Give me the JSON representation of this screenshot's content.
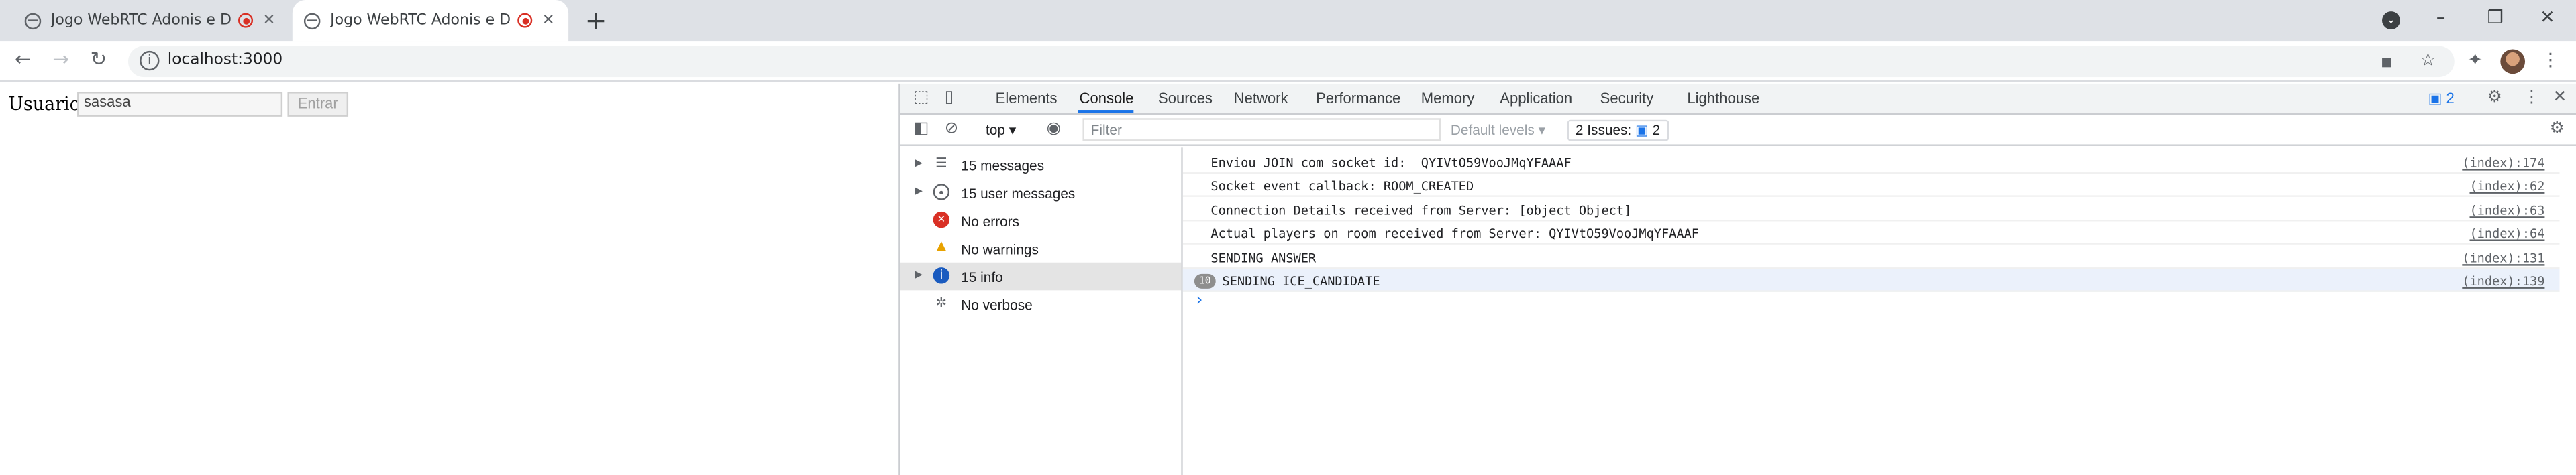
{
  "browser": {
    "tabs": [
      {
        "title": "Jogo WebRTC Adonis e Dou",
        "active": false
      },
      {
        "title": "Jogo WebRTC Adonis e Dou",
        "active": true
      }
    ],
    "new_tab": "+",
    "close_glyph": "✕",
    "url": "localhost:3000",
    "window_controls": [
      "–",
      "❐",
      "✕"
    ]
  },
  "page": {
    "user_label": "Usuario:",
    "user_value": "sasasa",
    "enter_button": "Entrar"
  },
  "devtools": {
    "tabs": [
      "Elements",
      "Console",
      "Sources",
      "Network",
      "Performance",
      "Memory",
      "Application",
      "Security",
      "Lighthouse"
    ],
    "active_tab": "Console",
    "message_badge": "2",
    "context": "top",
    "filter_placeholder": "Filter",
    "levels": "Default levels",
    "issues_label": "2 Issues:",
    "issues_count": "2",
    "sidebar": [
      {
        "label": "15 messages",
        "icon": "list-icon",
        "expandable": true
      },
      {
        "label": "15 user messages",
        "icon": "user-icon",
        "expandable": true
      },
      {
        "label": "No errors",
        "icon": "error-icon",
        "expandable": false
      },
      {
        "label": "No warnings",
        "icon": "warning-icon",
        "expandable": false
      },
      {
        "label": "15 info",
        "icon": "info-icon",
        "expandable": true,
        "selected": true
      },
      {
        "label": "No verbose",
        "icon": "bug-icon",
        "expandable": false
      }
    ],
    "log": [
      {
        "message": "Enviou JOIN com socket id:  QYIVtO59VooJMqYFAAAF",
        "source": "(index):174"
      },
      {
        "message": "Socket event callback: ROOM_CREATED",
        "source": "(index):62"
      },
      {
        "message": "Connection Details received from Server: [object Object]",
        "source": "(index):63"
      },
      {
        "message": "Actual players on room received from Server: QYIVtO59VooJMqYFAAAF",
        "source": "(index):64"
      },
      {
        "message": "SENDING ANSWER",
        "source": "(index):131"
      },
      {
        "message": "SENDING ICE_CANDIDATE",
        "source": "(index):139",
        "count": "10"
      }
    ],
    "prompt": "›"
  },
  "colors": {
    "accent": "#1a73e8",
    "record": "#d93025",
    "tabstrip": "#dee1e6"
  }
}
